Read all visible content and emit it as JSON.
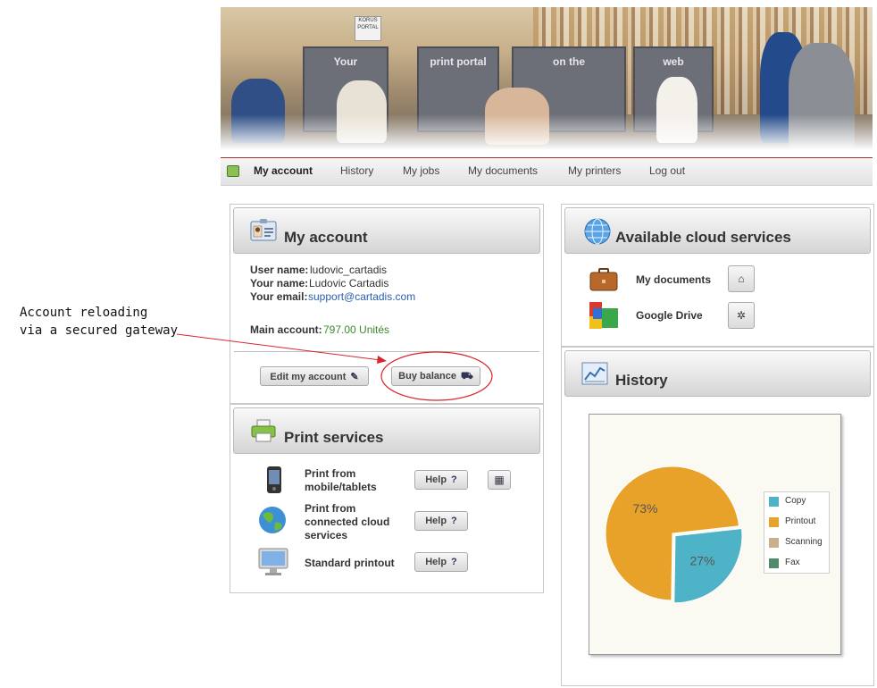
{
  "banner": {
    "logo_text": "KORUS PORTAL",
    "panels": [
      "Your",
      "print portal",
      "on the",
      "web"
    ]
  },
  "nav": {
    "items": [
      "My account",
      "History",
      "My jobs",
      "My documents",
      "My printers",
      "Log out"
    ],
    "active": "My account"
  },
  "account": {
    "title": "My account",
    "username_label": "User name:",
    "username": "ludovic_cartadis",
    "name_label": "Your name:",
    "name": "Ludovic Cartadis",
    "email_label": "Your email:",
    "email": "support@cartadis.com",
    "main_account_label": "Main account:",
    "main_account_value": "797.00 Unités",
    "edit_button": "Edit my account",
    "buy_button": "Buy balance"
  },
  "print_services": {
    "title": "Print services",
    "items": [
      {
        "label": "Print from mobile/tablets",
        "help": "Help"
      },
      {
        "label": "Print from connected cloud services",
        "help": "Help"
      },
      {
        "label": "Standard printout",
        "help": "Help"
      }
    ]
  },
  "cloud": {
    "title": "Available cloud services",
    "items": [
      {
        "label": "My documents"
      },
      {
        "label": "Google Drive"
      }
    ]
  },
  "history": {
    "title": "History"
  },
  "chart_data": {
    "type": "pie",
    "categories": [
      "Copy",
      "Printout",
      "Scanning",
      "Fax"
    ],
    "values": [
      27,
      73,
      0,
      0
    ],
    "slice_labels": [
      "27%",
      "73%"
    ],
    "colors": [
      "#4fb3c8",
      "#e8a22a",
      "#c9b08a",
      "#4f8a6a"
    ],
    "legend_position": "right"
  },
  "annotation": {
    "line1": "Account reloading",
    "line2": "via a secured gateway",
    "color": "#d9252e"
  }
}
